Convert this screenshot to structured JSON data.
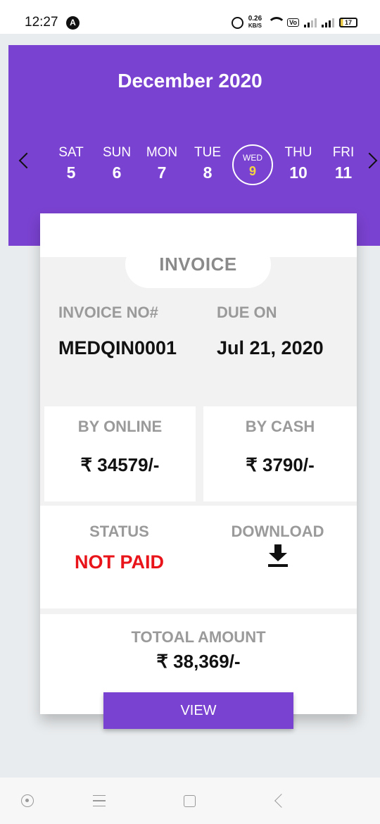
{
  "status_bar": {
    "time": "12:27",
    "notification_glyph": "A",
    "net_speed_value": "0.26",
    "net_speed_unit": "KB/S",
    "volte_label": "Vo",
    "battery_level": "17"
  },
  "calendar": {
    "month_title": "December 2020",
    "days": [
      {
        "name": "SAT",
        "num": "5"
      },
      {
        "name": "SUN",
        "num": "6"
      },
      {
        "name": "MON",
        "num": "7"
      },
      {
        "name": "TUE",
        "num": "8"
      },
      {
        "name": "WED",
        "num": "9"
      },
      {
        "name": "THU",
        "num": "10"
      },
      {
        "name": "FRI",
        "num": "11"
      }
    ],
    "selected_index": 4
  },
  "invoice": {
    "heading": "INVOICE",
    "invoice_no_label": "INVOICE NO#",
    "invoice_no_value": "MEDQIN0001",
    "due_label": "DUE ON",
    "due_value": "Jul 21, 2020",
    "online_label": "BY ONLINE",
    "online_value": "₹ 34579/-",
    "cash_label": "BY CASH",
    "cash_value": "₹ 3790/-",
    "status_label": "STATUS",
    "status_value": "NOT PAID",
    "download_label": "DOWNLOAD",
    "total_label": "TOTOAL AMOUNT",
    "total_value": "₹ 38,369/-",
    "view_button": "VIEW"
  },
  "colors": {
    "accent": "#7a42d0",
    "status_unpaid": "#e8141a",
    "selected_day_number": "#f5d640"
  }
}
